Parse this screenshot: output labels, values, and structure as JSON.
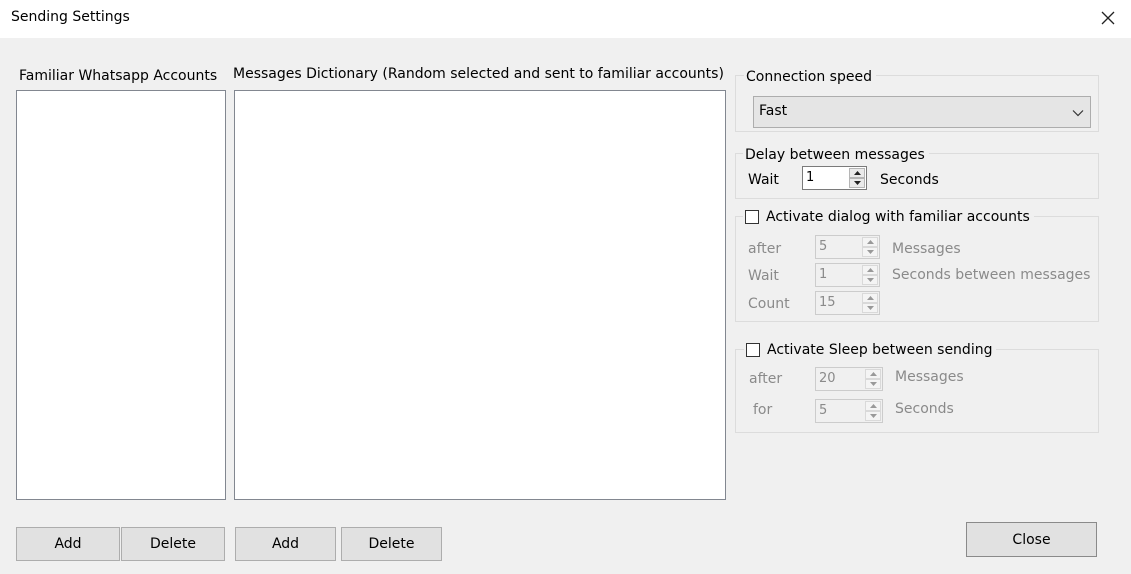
{
  "window": {
    "title": "Sending Settings"
  },
  "accounts": {
    "label": "Familiar Whatsapp Accounts",
    "add_label": "Add",
    "delete_label": "Delete"
  },
  "messages": {
    "label": "Messages Dictionary (Random selected and sent to familiar accounts)",
    "add_label": "Add",
    "delete_label": "Delete"
  },
  "connection": {
    "label": "Connection speed",
    "selected": "Fast"
  },
  "delay": {
    "label": "Delay between messages",
    "wait_label": "Wait",
    "value": "1",
    "unit": "Seconds"
  },
  "dialog": {
    "label": "Activate dialog with familiar accounts",
    "checked": false,
    "after_label": "after",
    "after_value": "5",
    "after_unit": "Messages",
    "wait_label": "Wait",
    "wait_value": "1",
    "wait_unit": "Seconds between messages",
    "count_label": "Count",
    "count_value": "15"
  },
  "sleep": {
    "label": "Activate Sleep between sending",
    "checked": false,
    "after_label": "after",
    "after_value": "20",
    "after_unit": "Messages",
    "for_label": "for",
    "for_value": "5",
    "for_unit": "Seconds"
  },
  "footer": {
    "close_label": "Close"
  }
}
